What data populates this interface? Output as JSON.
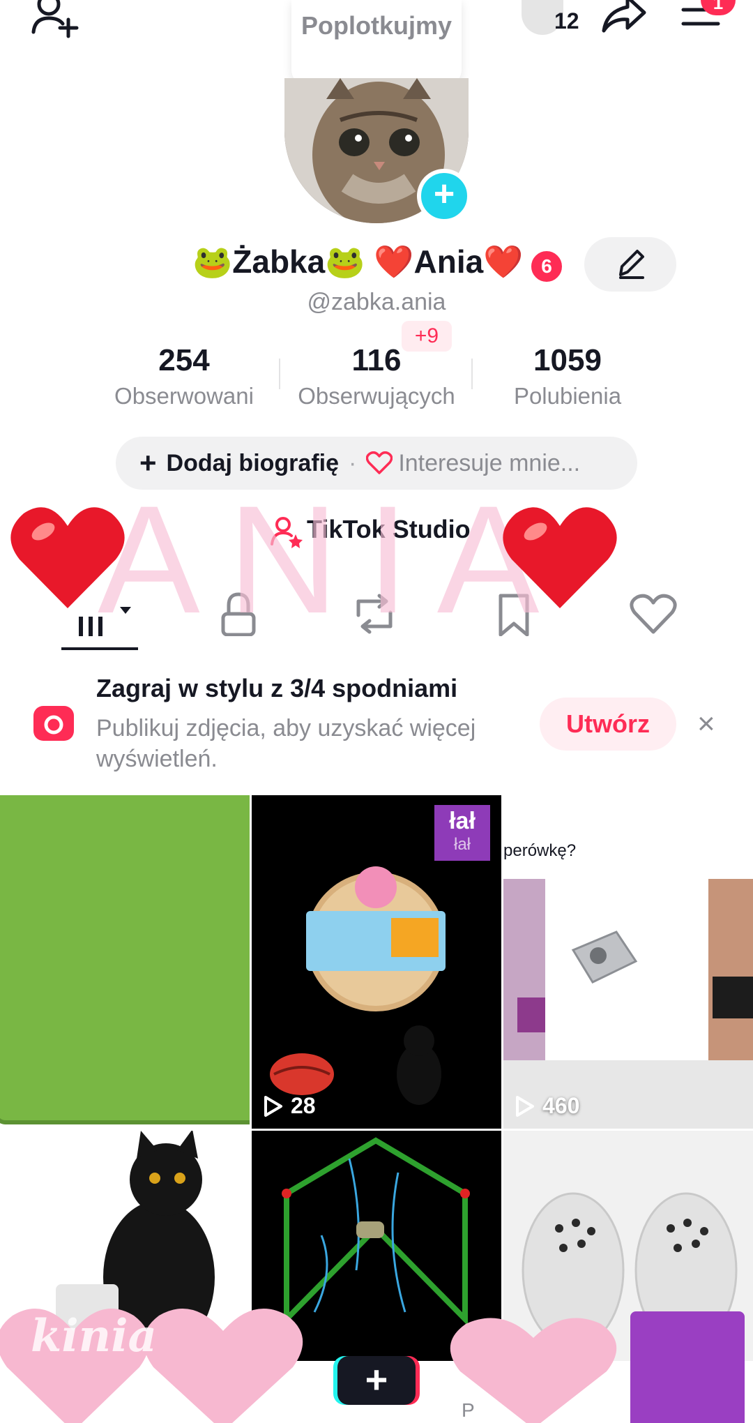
{
  "header": {
    "note": "Poplotkujmy",
    "views_count": "12",
    "menu_badge": "1"
  },
  "profile": {
    "display_name": "🐸Żabka🐸 ❤️Ania❤️",
    "name_badge": "6",
    "username": "@zabka.ania"
  },
  "stats": [
    {
      "value": "254",
      "label": "Obserwowani"
    },
    {
      "value": "116",
      "label": "Obserwujących",
      "badge": "+9"
    },
    {
      "value": "1059",
      "label": "Polubienia"
    }
  ],
  "bio": {
    "add_label": "Dodaj biografię",
    "separator": "·",
    "interests_label": "Interesuje mnie..."
  },
  "studio_label": "TikTok Studio",
  "overlay_text": "ANIA",
  "banner": {
    "title": "Zagraj w stylu z 3/4 spodniami",
    "subtitle": "Publikuj zdjęcia, aby uzyskać więcej wyświetleń.",
    "create_label": "Utwórz",
    "close_symbol": "×"
  },
  "grid": {
    "cell_2_logo_top": "łał",
    "cell_2_logo_bottom": "łał",
    "cell_2_count": "28",
    "cell_3_caption": "perówkę?",
    "cell_3_count": "460"
  },
  "bottom": {
    "watermark": "kinia",
    "cut_label": "P"
  },
  "colors": {
    "accent": "#fe2c55",
    "cyan": "#20d5ec",
    "text": "#161823",
    "muted": "#8a8b91",
    "pill": "#f1f1f2",
    "overlay_pink": "#f8bed6",
    "green_sticker": "#79b744",
    "purple_sticker": "#9a3fc2"
  },
  "icons": [
    "add-friend-icon",
    "share-icon",
    "menu-icon",
    "edit-icon",
    "grid-icon",
    "lock-icon",
    "repost-icon",
    "bookmark-icon",
    "heart-outline-icon",
    "camera-icon",
    "play-icon",
    "plus-icon",
    "studio-icon"
  ]
}
